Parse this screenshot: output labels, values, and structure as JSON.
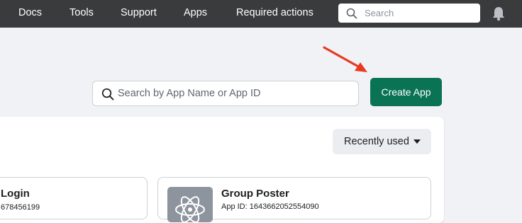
{
  "nav": {
    "items": [
      "Docs",
      "Tools",
      "Support",
      "Apps",
      "Required actions"
    ],
    "search_placeholder": "Search"
  },
  "toolbar": {
    "search_placeholder": "Search by App Name or App ID",
    "create_label": "Create App"
  },
  "sort": {
    "selected": "Recently used"
  },
  "apps": [
    {
      "name": "Login",
      "app_id": "678456199"
    },
    {
      "name": "Group Poster",
      "app_id": "App ID: 1643662052554090"
    }
  ],
  "colors": {
    "nav_bg": "#3a3b3c",
    "primary_button": "#0a7353",
    "annotation_arrow": "#e83a22"
  },
  "icons": [
    "search-icon",
    "bell-icon",
    "caret-down-icon",
    "atom-icon"
  ]
}
